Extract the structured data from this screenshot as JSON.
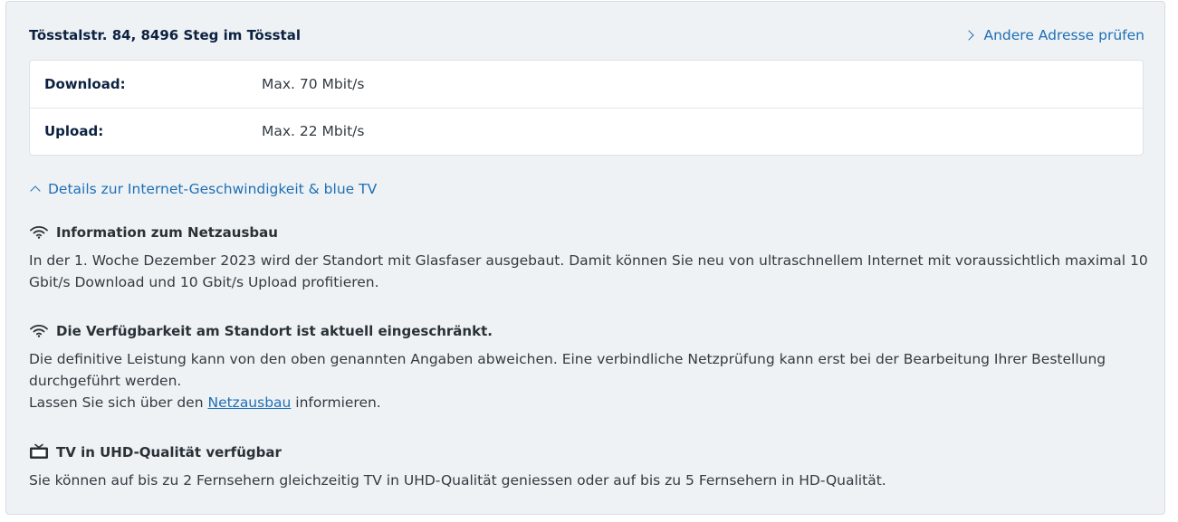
{
  "header": {
    "address": "Tösstalstr. 84, 8496 Steg im Tösstal",
    "other_address_link": "Andere Adresse prüfen"
  },
  "speeds": [
    {
      "label": "Download:",
      "value": "Max. 70 Mbit/s"
    },
    {
      "label": "Upload:",
      "value": "Max. 22 Mbit/s"
    }
  ],
  "details_toggle": "Details zur Internet-Geschwindigkeit & blue TV",
  "info": {
    "network_title": "Information zum Netzausbau",
    "network_text": "In der 1. Woche Dezember 2023 wird der Standort mit Glasfaser ausgebaut. Damit können Sie neu von ultraschnellem Internet mit voraussichtlich maximal 10 Gbit/s Download und 10 Gbit/s Upload profitieren.",
    "availability_title": "Die Verfügbarkeit am Standort ist aktuell eingeschränkt.",
    "availability_text": "Die definitive Leistung kann von den oben genannten Angaben abweichen. Eine verbindliche Netzprüfung kann erst bei der Bearbeitung Ihrer Bestellung durchgeführt werden.",
    "availability_link_prefix": "Lassen Sie sich über den ",
    "availability_link": "Netzausbau",
    "availability_link_suffix": " informieren.",
    "tv_title": "TV in UHD-Qualität verfügbar",
    "tv_text": "Sie können auf bis zu 2 Fernsehern gleichzeitig TV in UHD-Qualität geniessen oder auf bis zu 5 Fernsehern in HD-Qualität."
  },
  "icons": {
    "wifi": "wifi-icon",
    "tv": "tv-icon",
    "chevron_right": "chevron-right-icon",
    "chevron_up": "chevron-up-icon"
  },
  "colors": {
    "link": "#1f6fb5",
    "heading": "#0d2240",
    "panel_bg": "#eef2f5"
  }
}
